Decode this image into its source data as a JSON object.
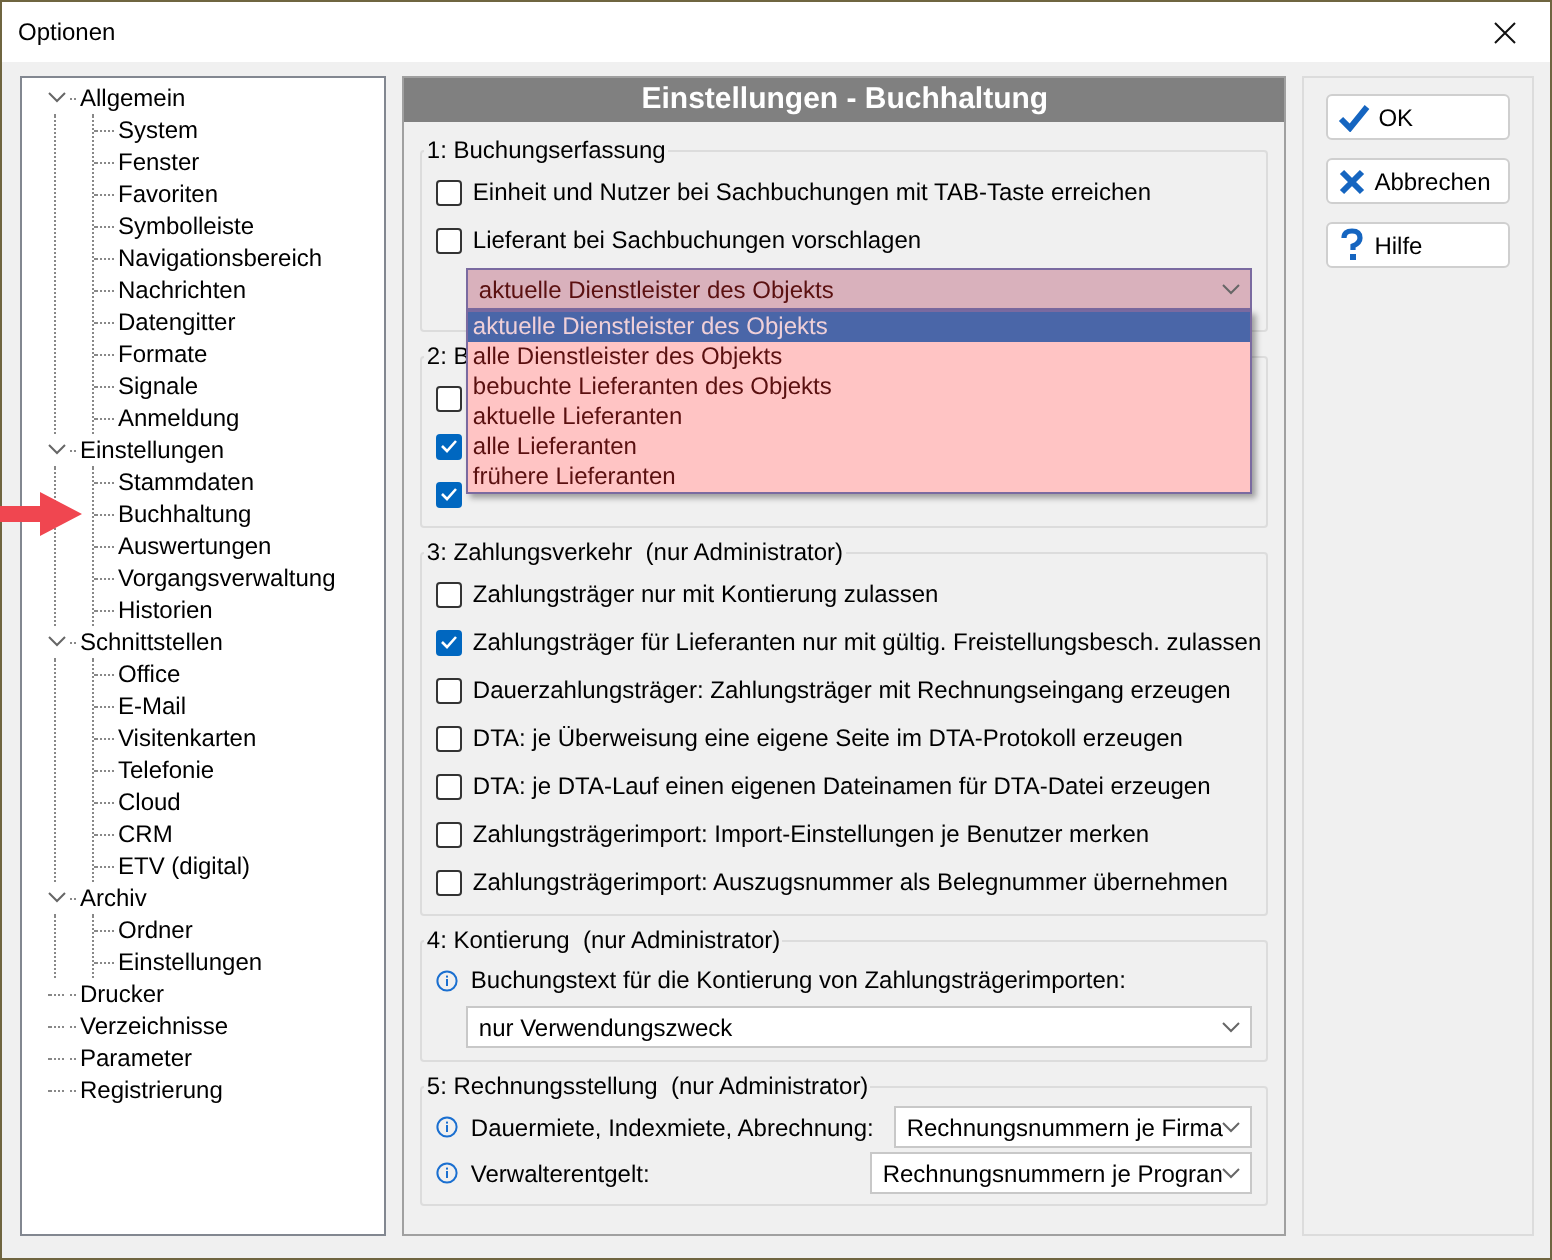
{
  "window": {
    "title": "Optionen"
  },
  "tree": [
    {
      "label": "Allgemein",
      "expanded": true,
      "children": [
        {
          "label": "System"
        },
        {
          "label": "Fenster"
        },
        {
          "label": "Favoriten"
        },
        {
          "label": "Symbolleiste"
        },
        {
          "label": "Navigationsbereich"
        },
        {
          "label": "Nachrichten"
        },
        {
          "label": "Datengitter"
        },
        {
          "label": "Formate"
        },
        {
          "label": "Signale"
        },
        {
          "label": "Anmeldung"
        }
      ]
    },
    {
      "label": "Einstellungen",
      "expanded": true,
      "children": [
        {
          "label": "Stammdaten"
        },
        {
          "label": "Buchhaltung",
          "marked": true
        },
        {
          "label": "Auswertungen"
        },
        {
          "label": "Vorgangsverwaltung"
        },
        {
          "label": "Historien"
        }
      ]
    },
    {
      "label": "Schnittstellen",
      "expanded": true,
      "children": [
        {
          "label": "Office"
        },
        {
          "label": "E-Mail"
        },
        {
          "label": "Visitenkarten"
        },
        {
          "label": "Telefonie"
        },
        {
          "label": "Cloud"
        },
        {
          "label": "CRM"
        },
        {
          "label": "ETV (digital)"
        }
      ]
    },
    {
      "label": "Archiv",
      "expanded": true,
      "children": [
        {
          "label": "Ordner"
        },
        {
          "label": "Einstellungen"
        }
      ]
    },
    {
      "label": "Drucker"
    },
    {
      "label": "Verzeichnisse"
    },
    {
      "label": "Parameter"
    },
    {
      "label": "Registrierung"
    }
  ],
  "panel": {
    "title": "Einstellungen - Buchhaltung",
    "sections": [
      {
        "legend": "1: Buchungserfassung",
        "rows": [
          {
            "kind": "checkbox",
            "label": "Einheit und Nutzer bei Sachbuchungen mit TAB-Taste erreichen",
            "checked": false
          },
          {
            "kind": "checkbox",
            "label": "Lieferant bei Sachbuchungen vorschlagen",
            "checked": false
          },
          {
            "kind": "open-select",
            "value": "aktuelle Dienstleister des Objekts",
            "options": [
              {
                "label": "aktuelle Dienstleister des Objekts",
                "selected": true
              },
              {
                "label": "alle Dienstleister des Objekts",
                "selected": false
              },
              {
                "label": "bebuchte Lieferanten des Objekts",
                "selected": false
              },
              {
                "label": "aktuelle Lieferanten",
                "selected": false
              },
              {
                "label": "alle Lieferanten",
                "selected": false
              },
              {
                "label": "frühere Lieferanten",
                "selected": false
              }
            ]
          }
        ]
      },
      {
        "legend": "2: B",
        "rows": [
          {
            "kind": "checkbox",
            "checked": false
          },
          {
            "kind": "checkbox",
            "checked": true
          },
          {
            "kind": "checkbox",
            "checked": true
          }
        ]
      },
      {
        "legend": "3: Zahlungsverkehr  (nur Administrator)",
        "rows": [
          {
            "kind": "checkbox",
            "label": "Zahlungsträger nur mit Kontierung zulassen",
            "checked": false
          },
          {
            "kind": "checkbox",
            "label": "Zahlungsträger für Lieferanten nur mit gültig. Freistellungsbesch. zulassen",
            "checked": true
          },
          {
            "kind": "checkbox",
            "label": "Dauerzahlungsträger: Zahlungsträger mit Rechnungseingang erzeugen",
            "checked": false
          },
          {
            "kind": "checkbox",
            "label": "DTA: je Überweisung eine eigene Seite im DTA-Protokoll erzeugen",
            "checked": false
          },
          {
            "kind": "checkbox",
            "label": "DTA: je DTA-Lauf einen eigenen Dateinamen für DTA-Datei erzeugen",
            "checked": false
          },
          {
            "kind": "checkbox",
            "label": "Zahlungsträgerimport: Import-Einstellungen je Benutzer merken",
            "checked": false
          },
          {
            "kind": "checkbox",
            "label": "Zahlungsträgerimport: Auszugsnummer als Belegnummer übernehmen",
            "checked": false
          }
        ]
      },
      {
        "legend": "4: Kontierung  (nur Administrator)",
        "rows": [
          {
            "kind": "info",
            "label": "Buchungstext für die Kontierung von Zahlungsträgerimporten:"
          },
          {
            "kind": "select",
            "value": "nur Verwendungszweck"
          }
        ]
      },
      {
        "legend": "5: Rechnungsstellung  (nur Administrator)",
        "rows": [
          {
            "kind": "info-select",
            "label": "Dauermiete, Indexmiete, Abrechnung:",
            "value": "Rechnungsnummern je Firma"
          },
          {
            "kind": "info-select",
            "label": "Verwalterentgelt:",
            "value": "Rechnungsnummern je Progran"
          }
        ]
      }
    ]
  },
  "buttons": [
    {
      "kind": "ok",
      "label": "OK"
    },
    {
      "kind": "cancel",
      "label": "Abbrechen"
    },
    {
      "kind": "help",
      "label": "Hilfe"
    }
  ]
}
